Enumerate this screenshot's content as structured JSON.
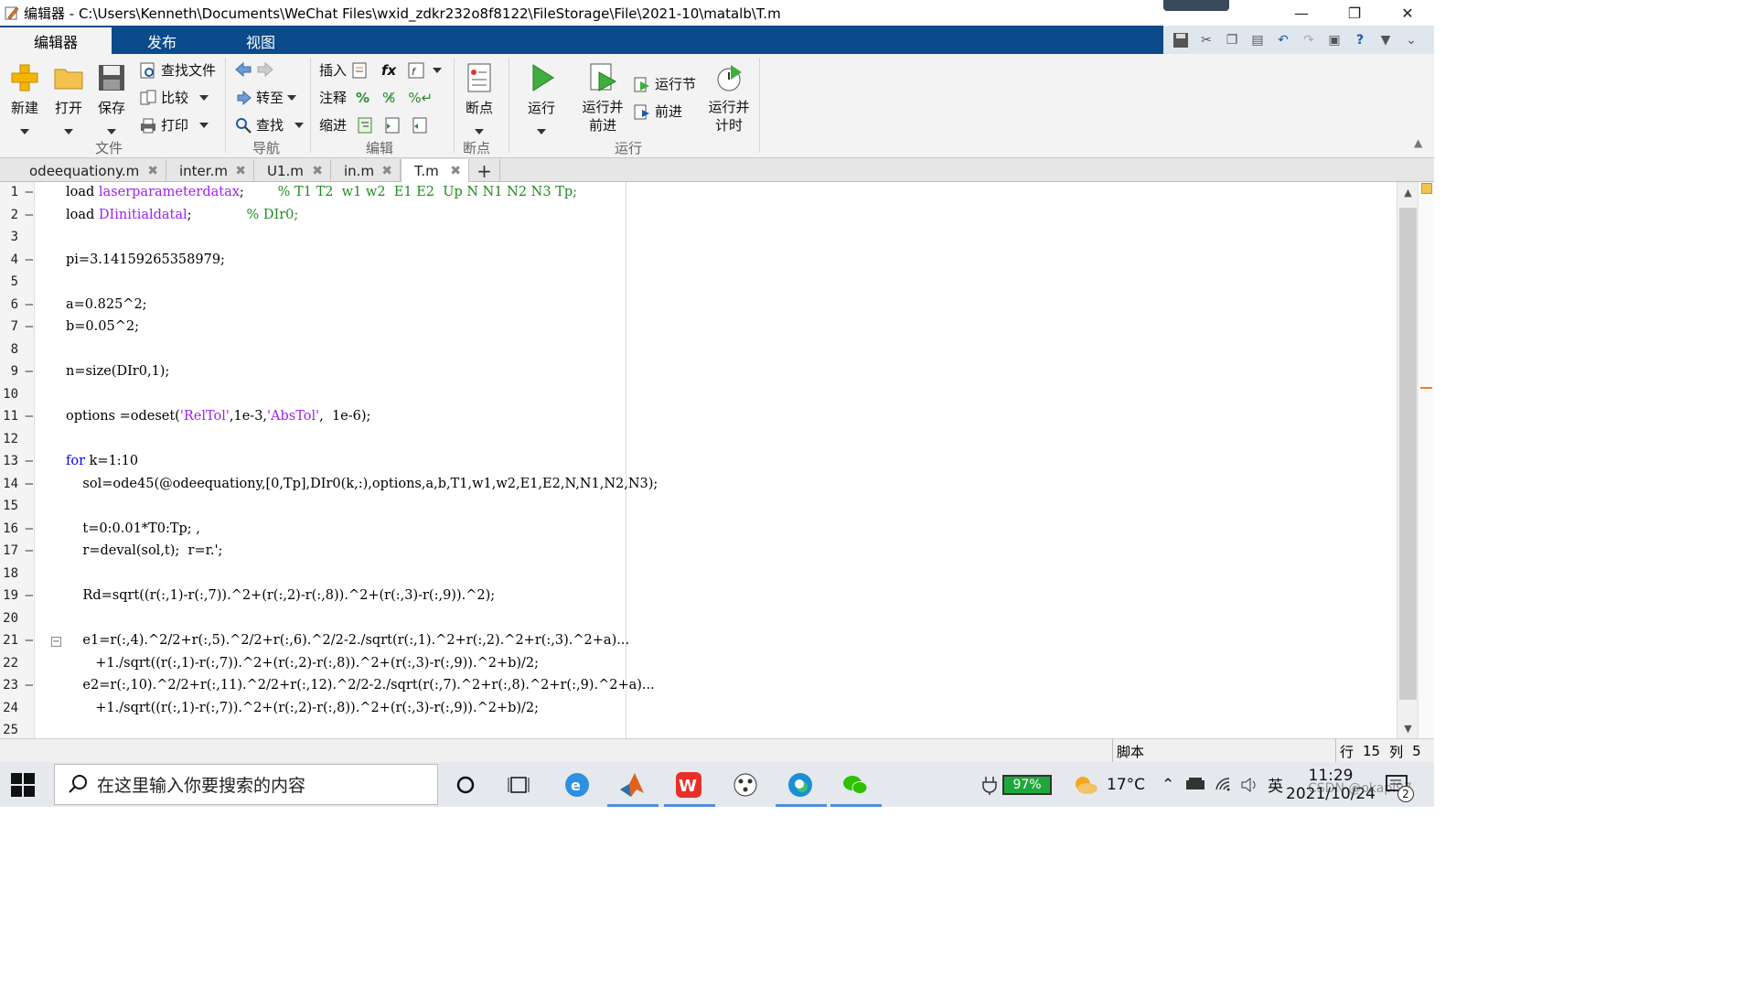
{
  "window": {
    "title": "编辑器 - C:\\Users\\Kenneth\\Documents\\WeChat Files\\wxid_zdkr232o8f8122\\FileStorage\\File\\2021-10\\matalb\\T.m"
  },
  "ribbon_tabs": [
    "编辑器",
    "发布",
    "视图"
  ],
  "ribbon": {
    "file": {
      "new": "新建",
      "open": "打开",
      "save": "保存",
      "find_files": "查找文件",
      "compare": "比较",
      "print": "打印",
      "section": "文件"
    },
    "nav": {
      "goto": "转至",
      "find": "查找",
      "section": "导航"
    },
    "edit": {
      "insert": "插入",
      "comment": "注释",
      "indent": "缩进",
      "fx": "fx",
      "section": "编辑"
    },
    "breakpoints": {
      "label": "断点",
      "section": "断点"
    },
    "run": {
      "run": "运行",
      "run_advance": "运行并\n前进",
      "run_section": "运行节",
      "advance": "前进",
      "run_time": "运行并\n计时",
      "section": "运行"
    }
  },
  "file_tabs": [
    "odeequationy.m",
    "inter.m",
    "U1.m",
    "in.m",
    "T.m"
  ],
  "active_file_tab": "T.m",
  "code_lines": [
    {
      "n": "1",
      "dash": true,
      "parts": [
        [
          "p",
          "load "
        ],
        [
          "s",
          "laserparameterdatax"
        ],
        [
          "p",
          ";        "
        ],
        [
          "c",
          "% T1 T2  w1 w2  E1 E2  Up N N1 N2 N3 Tp;"
        ]
      ]
    },
    {
      "n": "2",
      "dash": true,
      "parts": [
        [
          "p",
          "load "
        ],
        [
          "s",
          "DIinitialdatal"
        ],
        [
          "p",
          ";             "
        ],
        [
          "c",
          "% DIr0;"
        ]
      ]
    },
    {
      "n": "3",
      "dash": false,
      "parts": []
    },
    {
      "n": "4",
      "dash": true,
      "parts": [
        [
          "p",
          "pi=3.14159265358979;"
        ]
      ]
    },
    {
      "n": "5",
      "dash": false,
      "parts": []
    },
    {
      "n": "6",
      "dash": true,
      "parts": [
        [
          "p",
          "a=0.825^2;"
        ]
      ]
    },
    {
      "n": "7",
      "dash": true,
      "parts": [
        [
          "p",
          "b=0.05^2;"
        ]
      ]
    },
    {
      "n": "8",
      "dash": false,
      "parts": []
    },
    {
      "n": "9",
      "dash": true,
      "parts": [
        [
          "p",
          "n=size(DIr0,1);"
        ]
      ]
    },
    {
      "n": "10",
      "dash": false,
      "parts": []
    },
    {
      "n": "11",
      "dash": true,
      "parts": [
        [
          "p",
          "options =odeset("
        ],
        [
          "s",
          "'RelTol'"
        ],
        [
          "p",
          ",1e-3,"
        ],
        [
          "s",
          "'AbsTol'"
        ],
        [
          "p",
          ",  1e-6);"
        ]
      ]
    },
    {
      "n": "12",
      "dash": false,
      "parts": []
    },
    {
      "n": "13",
      "dash": true,
      "parts": [
        [
          "k",
          "for"
        ],
        [
          "p",
          " k=1:10"
        ]
      ]
    },
    {
      "n": "14",
      "dash": true,
      "parts": [
        [
          "p",
          "    sol=ode45(@odeequationy,[0,Tp],DIr0(k,:),options,a,b,T1,w1,w2,E1,E2,N,N1,N2,N3);"
        ]
      ]
    },
    {
      "n": "15",
      "dash": false,
      "parts": []
    },
    {
      "n": "16",
      "dash": true,
      "parts": [
        [
          "p",
          "    t=0:0.01*T0:Tp; ,"
        ]
      ]
    },
    {
      "n": "17",
      "dash": true,
      "parts": [
        [
          "p",
          "    r=deval(sol,t);  r=r.';"
        ]
      ]
    },
    {
      "n": "18",
      "dash": false,
      "parts": []
    },
    {
      "n": "19",
      "dash": true,
      "parts": [
        [
          "p",
          "    Rd=sqrt((r(:,1)-r(:,7)).^2+(r(:,2)-r(:,8)).^2+(r(:,3)-r(:,9)).^2);"
        ]
      ]
    },
    {
      "n": "20",
      "dash": false,
      "parts": []
    },
    {
      "n": "21",
      "dash": true,
      "parts": [
        [
          "p",
          "    e1=r(:,4).^2/2+r(:,5).^2/2+r(:,6).^2/2-2./sqrt(r(:,1).^2+r(:,2).^2+r(:,3).^2+a)..."
        ]
      ]
    },
    {
      "n": "22",
      "dash": false,
      "parts": [
        [
          "p",
          "       +1./sqrt((r(:,1)-r(:,7)).^2+(r(:,2)-r(:,8)).^2+(r(:,3)-r(:,9)).^2+b)/2;"
        ]
      ]
    },
    {
      "n": "23",
      "dash": true,
      "parts": [
        [
          "p",
          "    e2=r(:,10).^2/2+r(:,11).^2/2+r(:,12).^2/2-2./sqrt(r(:,7).^2+r(:,8).^2+r(:,9).^2+a)..."
        ]
      ]
    },
    {
      "n": "24",
      "dash": false,
      "parts": [
        [
          "p",
          "       +1./sqrt((r(:,1)-r(:,7)).^2+(r(:,2)-r(:,8)).^2+(r(:,3)-r(:,9)).^2+b)/2;"
        ]
      ]
    },
    {
      "n": "25",
      "dash": false,
      "parts": []
    }
  ],
  "status": {
    "mode": "脚本",
    "row_label": "行",
    "row": "15",
    "col_label": "列",
    "col": "5"
  },
  "taskbar": {
    "search_placeholder": "在这里输入你要搜索的内容",
    "battery": "97%",
    "weather": "17°C",
    "ime": "英",
    "time": "11:29",
    "date": "2021/10/24",
    "notifications": "2",
    "watermark": "CSDN @okapi97"
  }
}
